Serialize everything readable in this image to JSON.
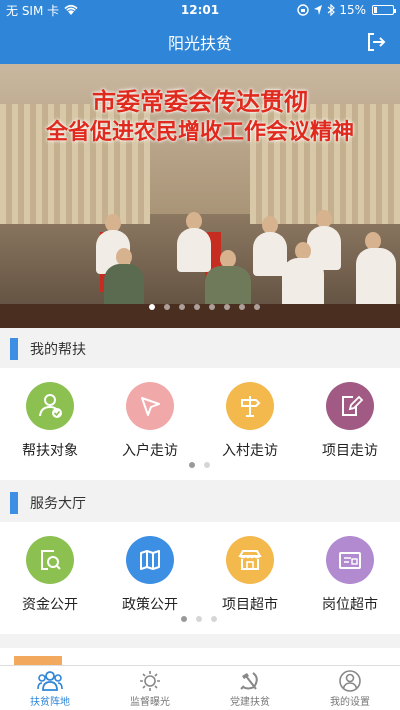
{
  "status": {
    "carrier": "无 SIM 卡",
    "time": "12:01",
    "battery": "15%",
    "battery_level": 0.15
  },
  "nav": {
    "title": "阳光扶贫"
  },
  "banner": {
    "title_line1": "市委常委会传达贯彻",
    "title_line2": "全省促进农民增收工作会议精神",
    "slide_count": 8,
    "active_slide": 0
  },
  "help_section": {
    "title": "我的帮扶",
    "items": [
      {
        "label": "帮扶对象",
        "icon": "person-check-icon",
        "color": "#8cc152"
      },
      {
        "label": "入户走访",
        "icon": "location-arrow-icon",
        "color": "#f1a8a8"
      },
      {
        "label": "入村走访",
        "icon": "signpost-icon",
        "color": "#f3b94d"
      },
      {
        "label": "项目走访",
        "icon": "edit-document-icon",
        "color": "#a05a84"
      }
    ],
    "pages": 2,
    "active_page": 0
  },
  "service_section": {
    "title": "服务大厅",
    "items": [
      {
        "label": "资金公开",
        "icon": "search-document-icon",
        "color": "#8cc152"
      },
      {
        "label": "政策公开",
        "icon": "map-icon",
        "color": "#3d8fe3"
      },
      {
        "label": "项目超市",
        "icon": "store-icon",
        "color": "#f3b94d"
      },
      {
        "label": "岗位超市",
        "icon": "job-card-icon",
        "color": "#b18ad0"
      }
    ],
    "pages": 3,
    "active_page": 0
  },
  "tabs": [
    {
      "label": "扶贫阵地",
      "icon": "group-icon",
      "active": true
    },
    {
      "label": "监督曝光",
      "icon": "sun-icon",
      "active": false
    },
    {
      "label": "党建扶贫",
      "icon": "hammer-sickle-icon",
      "active": false
    },
    {
      "label": "我的设置",
      "icon": "user-icon",
      "active": false
    }
  ],
  "colors": {
    "primary": "#2f86d8",
    "accent_bar": "#3d8fe3"
  }
}
